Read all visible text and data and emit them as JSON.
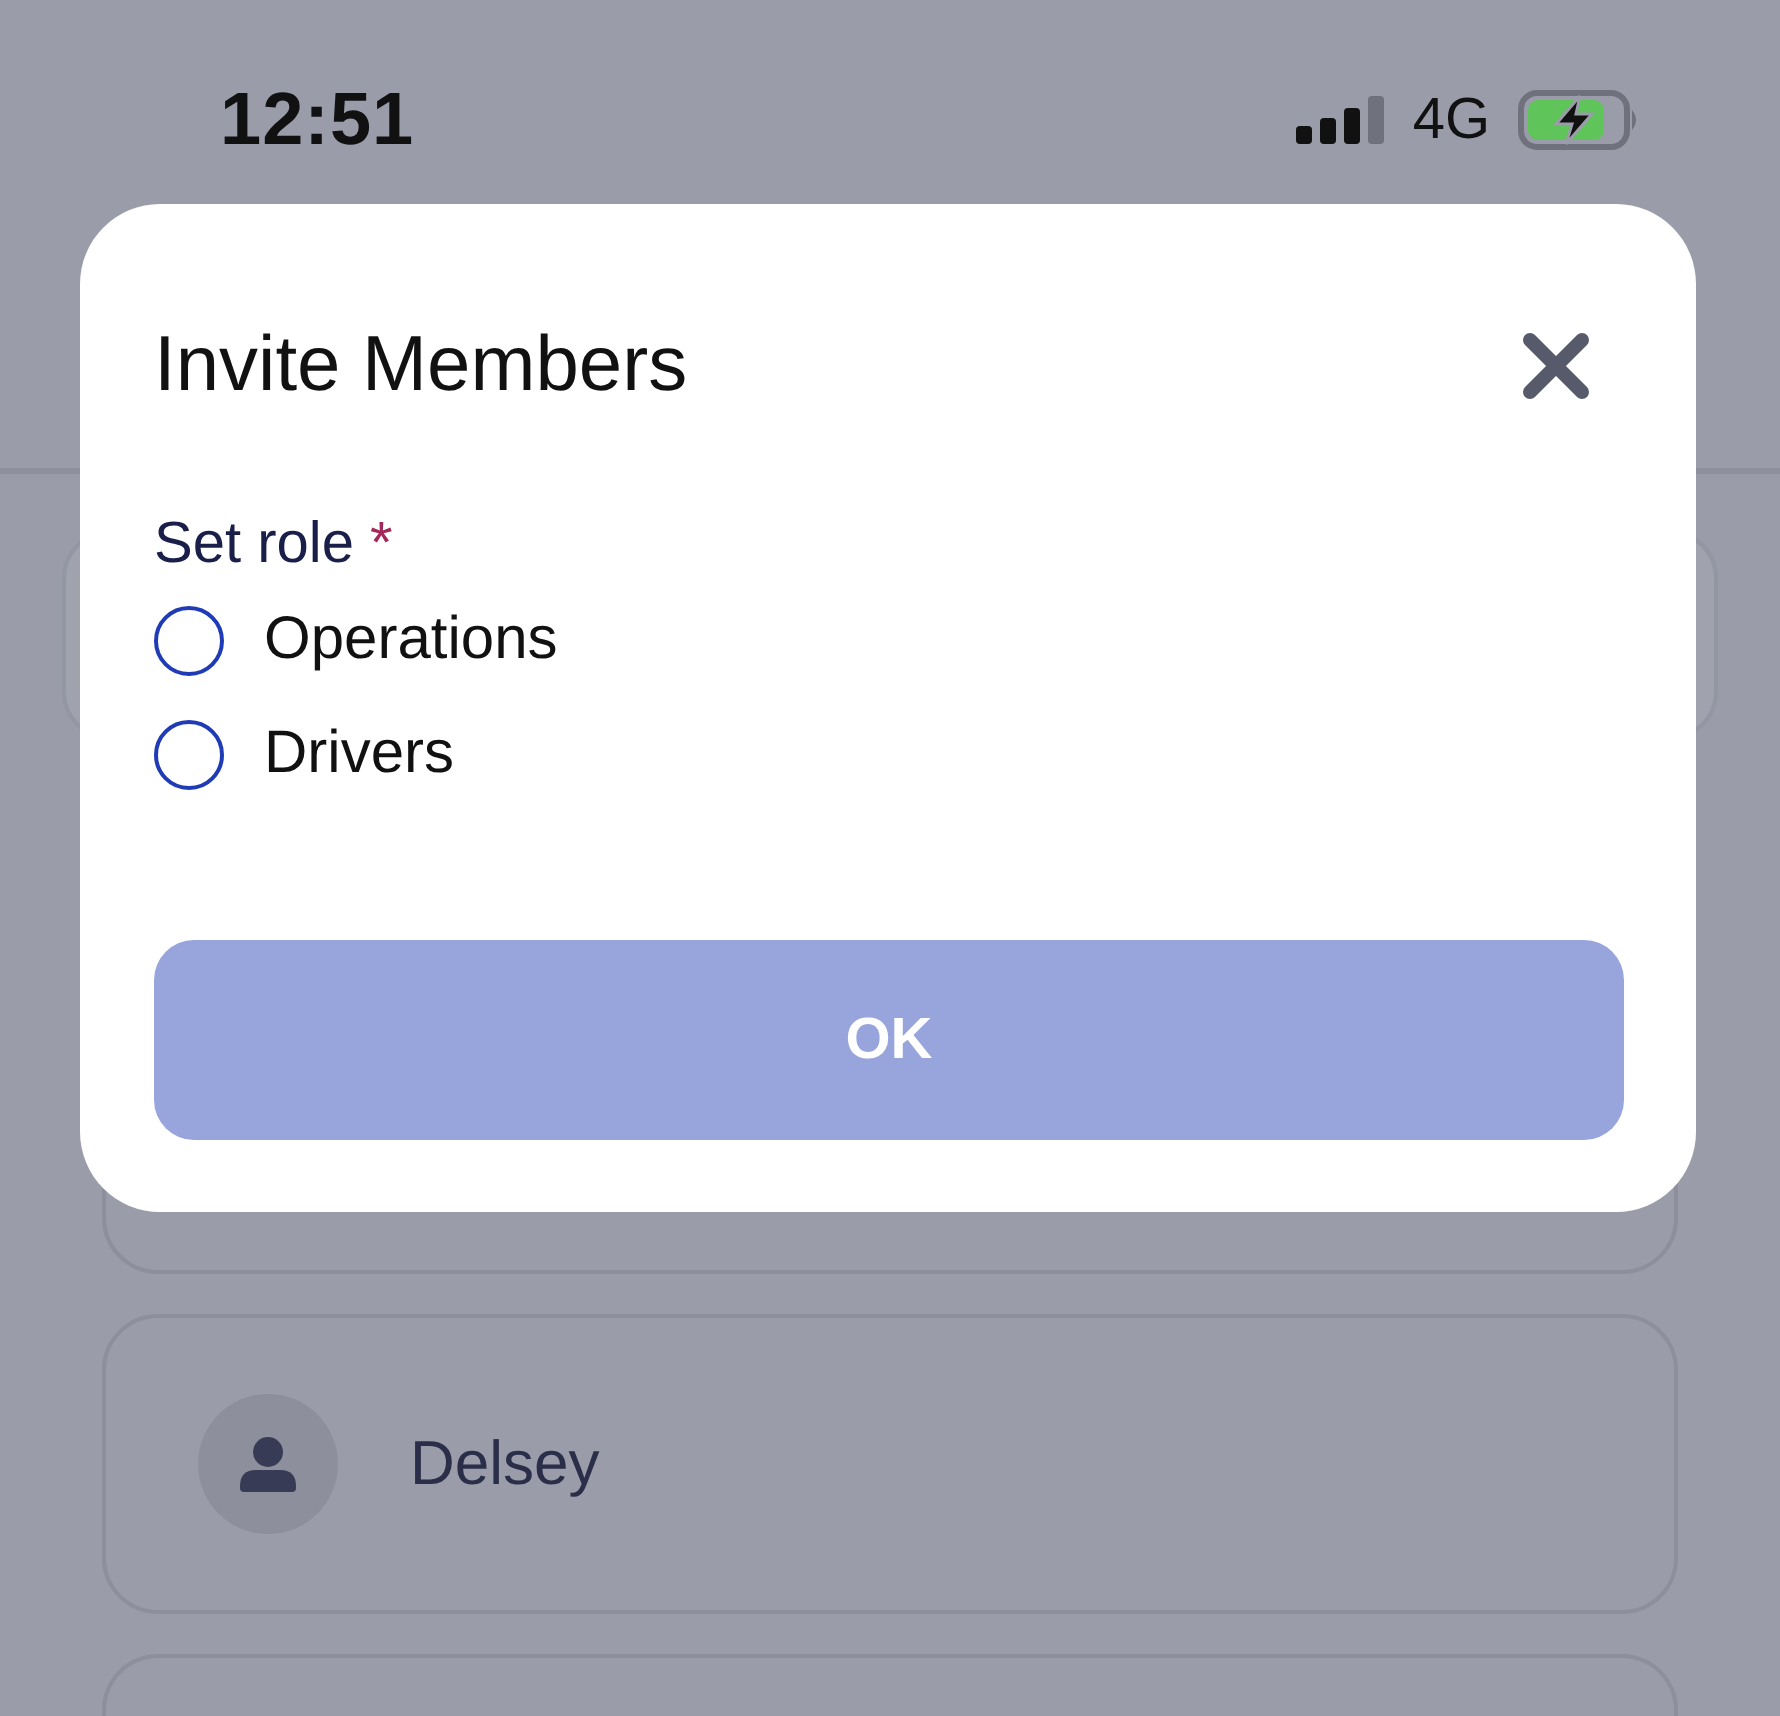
{
  "status_bar": {
    "time": "12:51",
    "network": "4G"
  },
  "member_list": [
    {
      "name": "Delsey"
    }
  ],
  "dialog": {
    "title": "Invite Members",
    "field": {
      "label": "Set role",
      "required_mark": "*",
      "options": [
        {
          "label": "Operations",
          "selected": false
        },
        {
          "label": "Drivers",
          "selected": false
        }
      ]
    },
    "button": {
      "label": "OK",
      "disabled": true
    }
  }
}
